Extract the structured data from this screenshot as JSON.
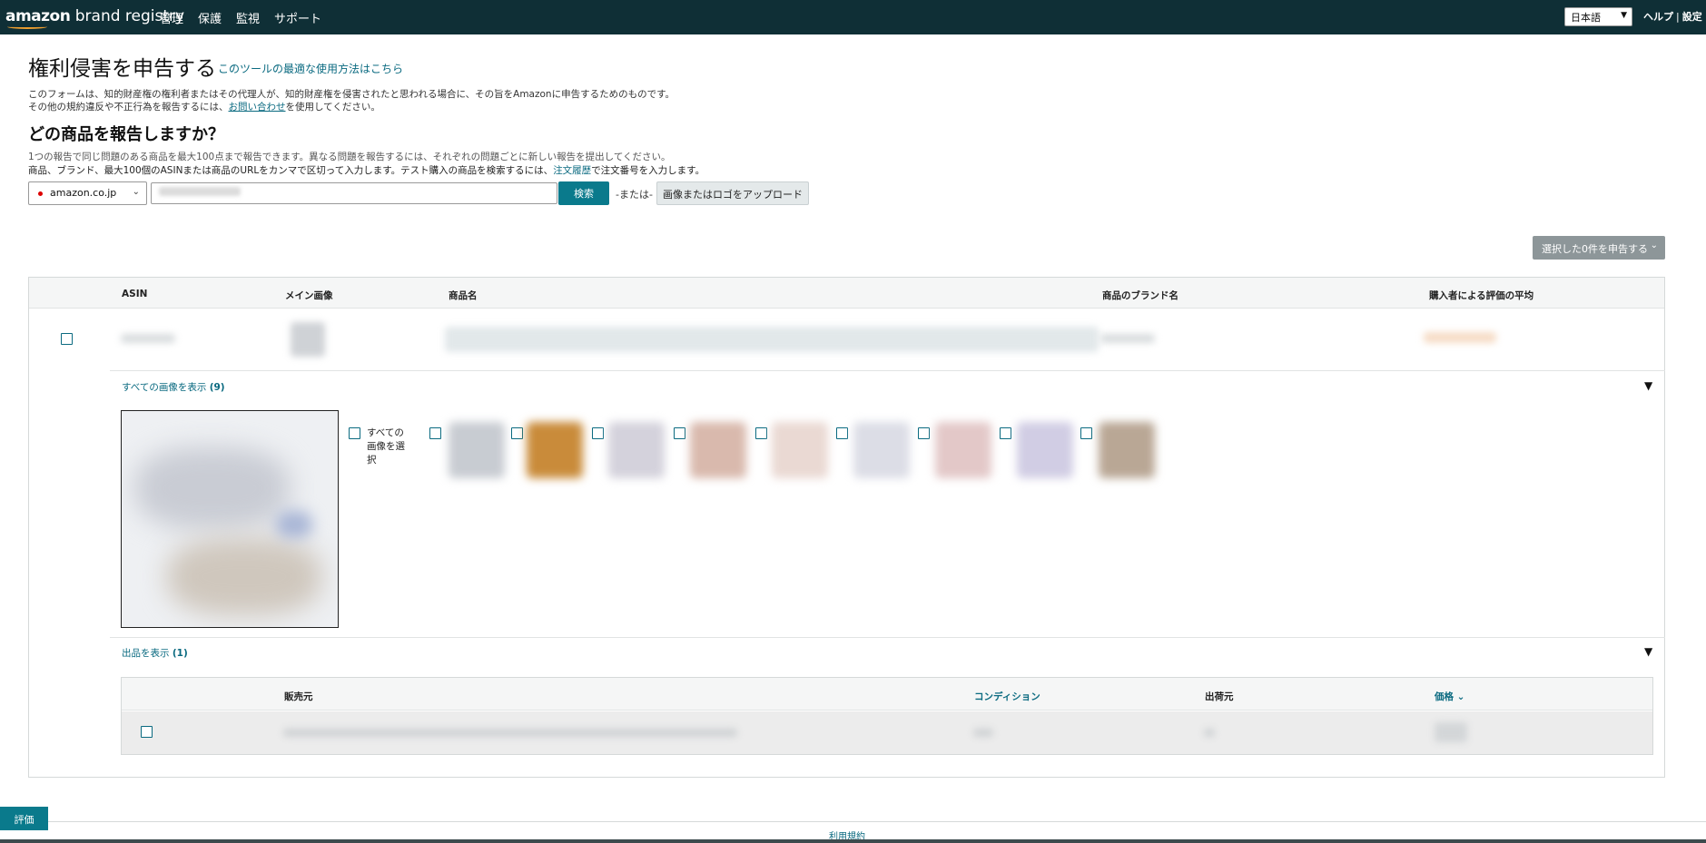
{
  "brand": {
    "logo_amazon": "amazon",
    "logo_rest": " brand registry"
  },
  "nav": {
    "items": [
      "管理",
      "保護",
      "監視",
      "サポート"
    ]
  },
  "header_right": {
    "language": "日本語",
    "help": "ヘルプ",
    "sep": "|",
    "settings": "設定"
  },
  "page": {
    "title": "権利侵害を申告する",
    "title_link": "このツールの最適な使用方法はこちら",
    "desc1": "このフォームは、知的財産権の権利者またはその代理人が、知的財産権を侵害されたと思われる場合に、その旨をAmazonに申告するためのものです。",
    "desc2_pre": "その他の規約違反や不正行為を報告するには、",
    "desc2_link": "お問い合わせ",
    "desc2_post": "を使用してください。",
    "question": "どの商品を報告しますか？",
    "sub1": "1つの報告で同じ問題のある商品を最大100点まで報告できます。異なる問題を報告するには、それぞれの問題ごとに新しい報告を提出してください。",
    "sub2_pre": "商品、ブランド、最大100個のASINまたは商品のURLをカンマで区切って入力します。テスト購入の商品を検索するには、",
    "sub2_link": "注文履歴",
    "sub2_post": "で注文番号を入力します。"
  },
  "search": {
    "marketplace": "amazon.co.jp",
    "button": "検索",
    "or": "-または-",
    "upload": "画像またはロゴをアップロード"
  },
  "report_selected": "選択した0件を申告する",
  "table": {
    "headers": {
      "asin": "ASIN",
      "main_image": "メイン画像",
      "product_name": "商品名",
      "brand_name": "商品のブランド名",
      "rating": "購入者による評価の平均"
    },
    "show_images": "すべての画像を表示",
    "image_count": "(9)",
    "select_all": [
      "すべての",
      "画像を選",
      "択"
    ],
    "show_offers": "出品を表示",
    "offer_count": "(1)",
    "offers": {
      "seller": "販売元",
      "condition": "コンディション",
      "shipper": "出荷元",
      "price": "価格"
    },
    "thumb_colors": [
      "#c8ccd2",
      "#c98b3a",
      "#d4d2dc",
      "#d9b9ad",
      "#ead9d3",
      "#dcdde6",
      "#e3c8c8",
      "#d1cde4",
      "#b9a795"
    ]
  },
  "footer": {
    "evaluate": "評価",
    "terms": "利用規約"
  }
}
